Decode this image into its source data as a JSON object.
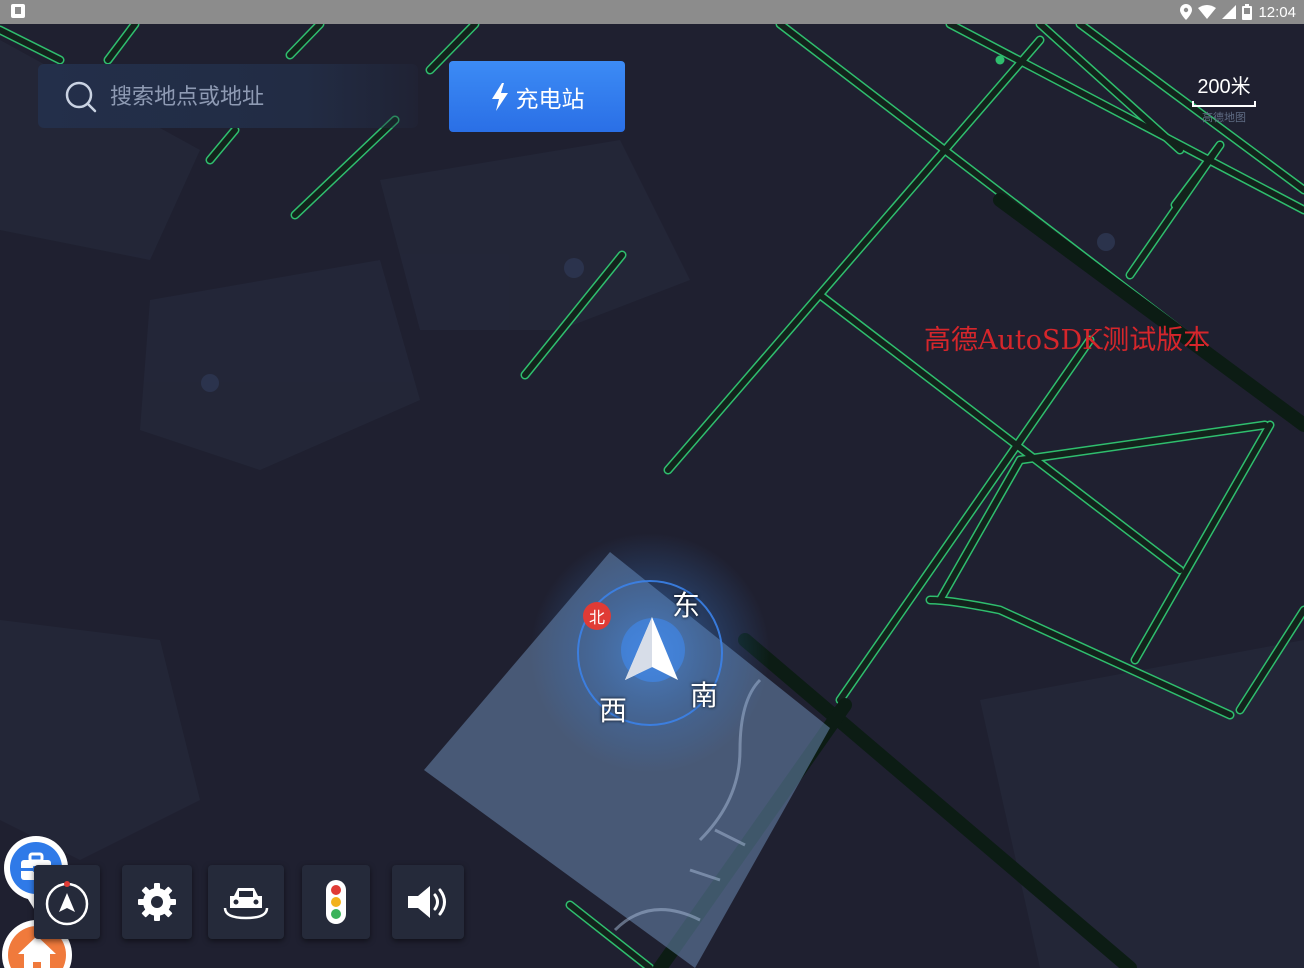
{
  "status_bar": {
    "time": "12:04"
  },
  "search": {
    "placeholder": "搜索地点或地址",
    "value": ""
  },
  "charge_button": {
    "label": "充电站"
  },
  "scale": {
    "label": "200米",
    "sub_label": "高德地图"
  },
  "watermark": "高德AutoSDK测试版本",
  "compass": {
    "north": "北",
    "east": "东",
    "south": "南",
    "west": "西"
  },
  "toolbar": {
    "items": [
      {
        "icon": "compass-icon"
      },
      {
        "icon": "settings-gear-icon"
      },
      {
        "icon": "car-view-icon"
      },
      {
        "icon": "traffic-light-icon"
      },
      {
        "icon": "volume-icon"
      }
    ]
  },
  "markers": [
    {
      "icon": "briefcase-icon",
      "type": "company"
    },
    {
      "icon": "home-icon",
      "type": "home"
    }
  ],
  "colors": {
    "map_background": "#1f2030",
    "road": "#2fbe6e",
    "charge_button": "#2f78ee",
    "watermark": "#d6262b",
    "position_area": "#6a88b0"
  }
}
